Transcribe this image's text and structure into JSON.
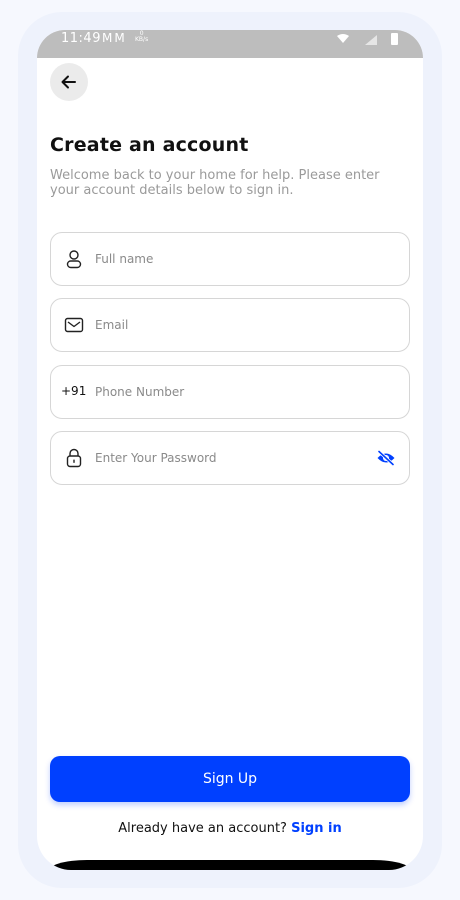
{
  "status_bar": {
    "time": "11:49",
    "mail_icons": "MM",
    "net_speed_value": "0",
    "net_speed_unit": "KB/s"
  },
  "header": {
    "title": "Create an account",
    "subtitle": "Welcome back to your home for help. Please enter your account details below to sign in."
  },
  "form": {
    "full_name": {
      "placeholder": "Full name",
      "value": "",
      "icon": "user-icon"
    },
    "email": {
      "placeholder": "Email",
      "value": "",
      "icon": "mail-icon"
    },
    "phone": {
      "country_code": "+91",
      "placeholder": "Phone Number",
      "value": ""
    },
    "password": {
      "placeholder": "Enter Your Password",
      "value": "",
      "icon": "lock-icon",
      "toggle_icon": "eye-off-icon"
    }
  },
  "actions": {
    "signup_label": "Sign Up",
    "footer_text": "Already have an account?",
    "signin_label": "Sign in"
  },
  "colors": {
    "accent": "#0040ff",
    "status_bar": "#bdbdbd"
  }
}
